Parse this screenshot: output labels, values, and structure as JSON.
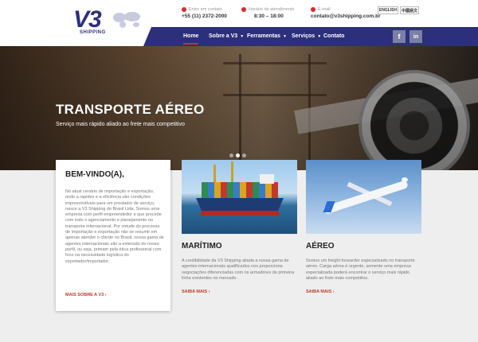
{
  "header": {
    "logo_text": "V3",
    "logo_sub": "SHIPPING",
    "contacts": [
      {
        "label": "Entre em contato",
        "value": "+55 (11) 2372-2000",
        "icon": "phone-icon"
      },
      {
        "label": "Horário de atendimento",
        "value": "8:30 – 18:00",
        "icon": "clock-icon"
      },
      {
        "label": "E-mail",
        "value": "contato@v3shipping.com.br",
        "icon": "mail-icon"
      }
    ],
    "languages": [
      "ENGLISH",
      "中國語文"
    ],
    "brand_color": "#2c2f7a",
    "accent_color": "#d7282f"
  },
  "nav": {
    "items": [
      {
        "label": "Home",
        "active": true
      },
      {
        "label": "Sobre a V3",
        "dropdown": true
      },
      {
        "label": "Ferramentas",
        "dropdown": true
      },
      {
        "label": "Serviços",
        "dropdown": true
      },
      {
        "label": "Contato"
      }
    ],
    "social": [
      "f",
      "in"
    ]
  },
  "hero": {
    "title": "TRANSPORTE AÉREO",
    "subtitle": "Serviço mais rápido aliado ao frete mais competitivo",
    "slide_count": 3,
    "active_slide": 2
  },
  "welcome": {
    "title": "BEM-VINDO(A),",
    "text": "No atual cenário de importação e exportação, onde a rapidez e a eficiência são condições imprescindíveis para um prestador de serviço, nasce a V3 Shipping do Brasil Ltda. Somos uma empresa com perfil empreendedor e que procede com todo o agenciamento e planejamento no transporte internacional. Por virtude do processo de importação e exportação não se resumir em apenas atender o cliente no Brasil, nossa gama de agentes internacionais são a extensão do nosso perfil, ou seja, primam pela ética profissional com foco na necessidade logística do exportador/importador.",
    "link": "MAIS SOBRE A V3 ›"
  },
  "services": [
    {
      "title": "MARÍTIMO",
      "text": "A credibilidade da V3 Shipping aliada a nossa gama de agentes internacionais qualificados nos proporciona negociações diferenciadas com os armadores de primeira linha existentes no mercado.",
      "link": "SAIBA MAIS ›"
    },
    {
      "title": "AÉREO",
      "text": "Somos um freight forwarder especializado no transporte aéreo. Carga aérea é urgente, somente uma empresa especializada poderá encontrar o serviço mais rápido aliado ao frete mais competitivo.",
      "link": "SAIBA MAIS ›"
    }
  ]
}
